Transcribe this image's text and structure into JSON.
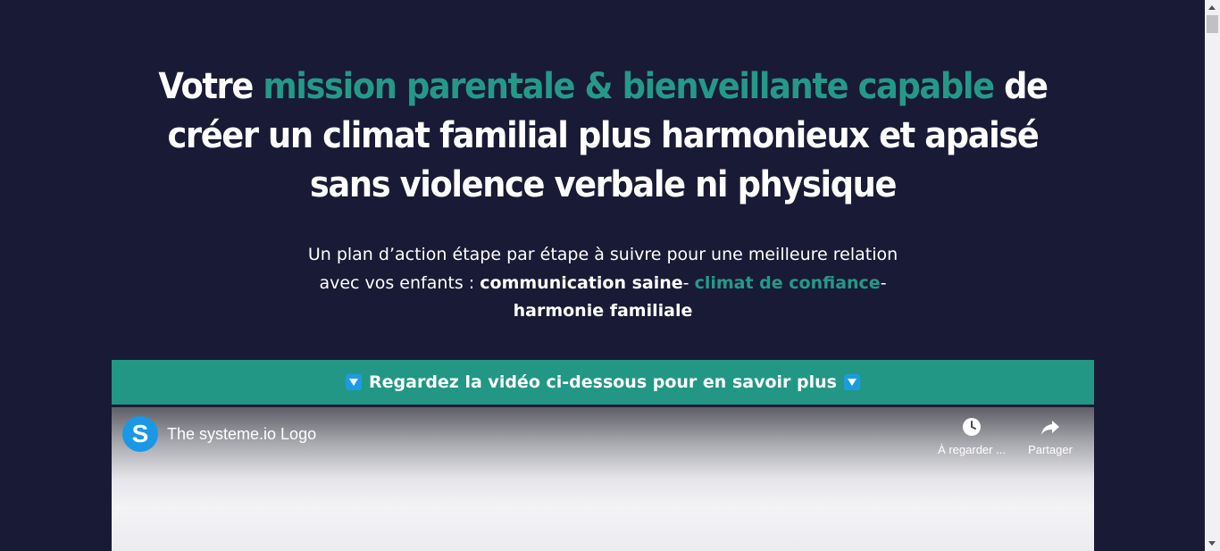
{
  "headline": {
    "part1": "Votre ",
    "accent": "mission parentale & bienveillante capable",
    "part2": " de créer un climat familial plus harmonieux et apaisé sans violence verbale ni physique"
  },
  "subhead": {
    "intro": "Un plan d’action étape par étape à suivre pour une meilleure relation avec vos enfants : ",
    "item1": "communication saine",
    "sep1": "- ",
    "item2": "climat de confiance",
    "sep2": "- ",
    "item3": "harmonie familiale"
  },
  "banner": {
    "text": "Regardez la vidéo ci-dessous pour en savoir plus"
  },
  "video": {
    "logo_letter": "S",
    "title": "The systeme.io Logo",
    "watch_later_label": "À regarder ...",
    "share_label": "Partager"
  },
  "colors": {
    "background": "#191a35",
    "accent": "#24998a",
    "banner": "#229785"
  }
}
